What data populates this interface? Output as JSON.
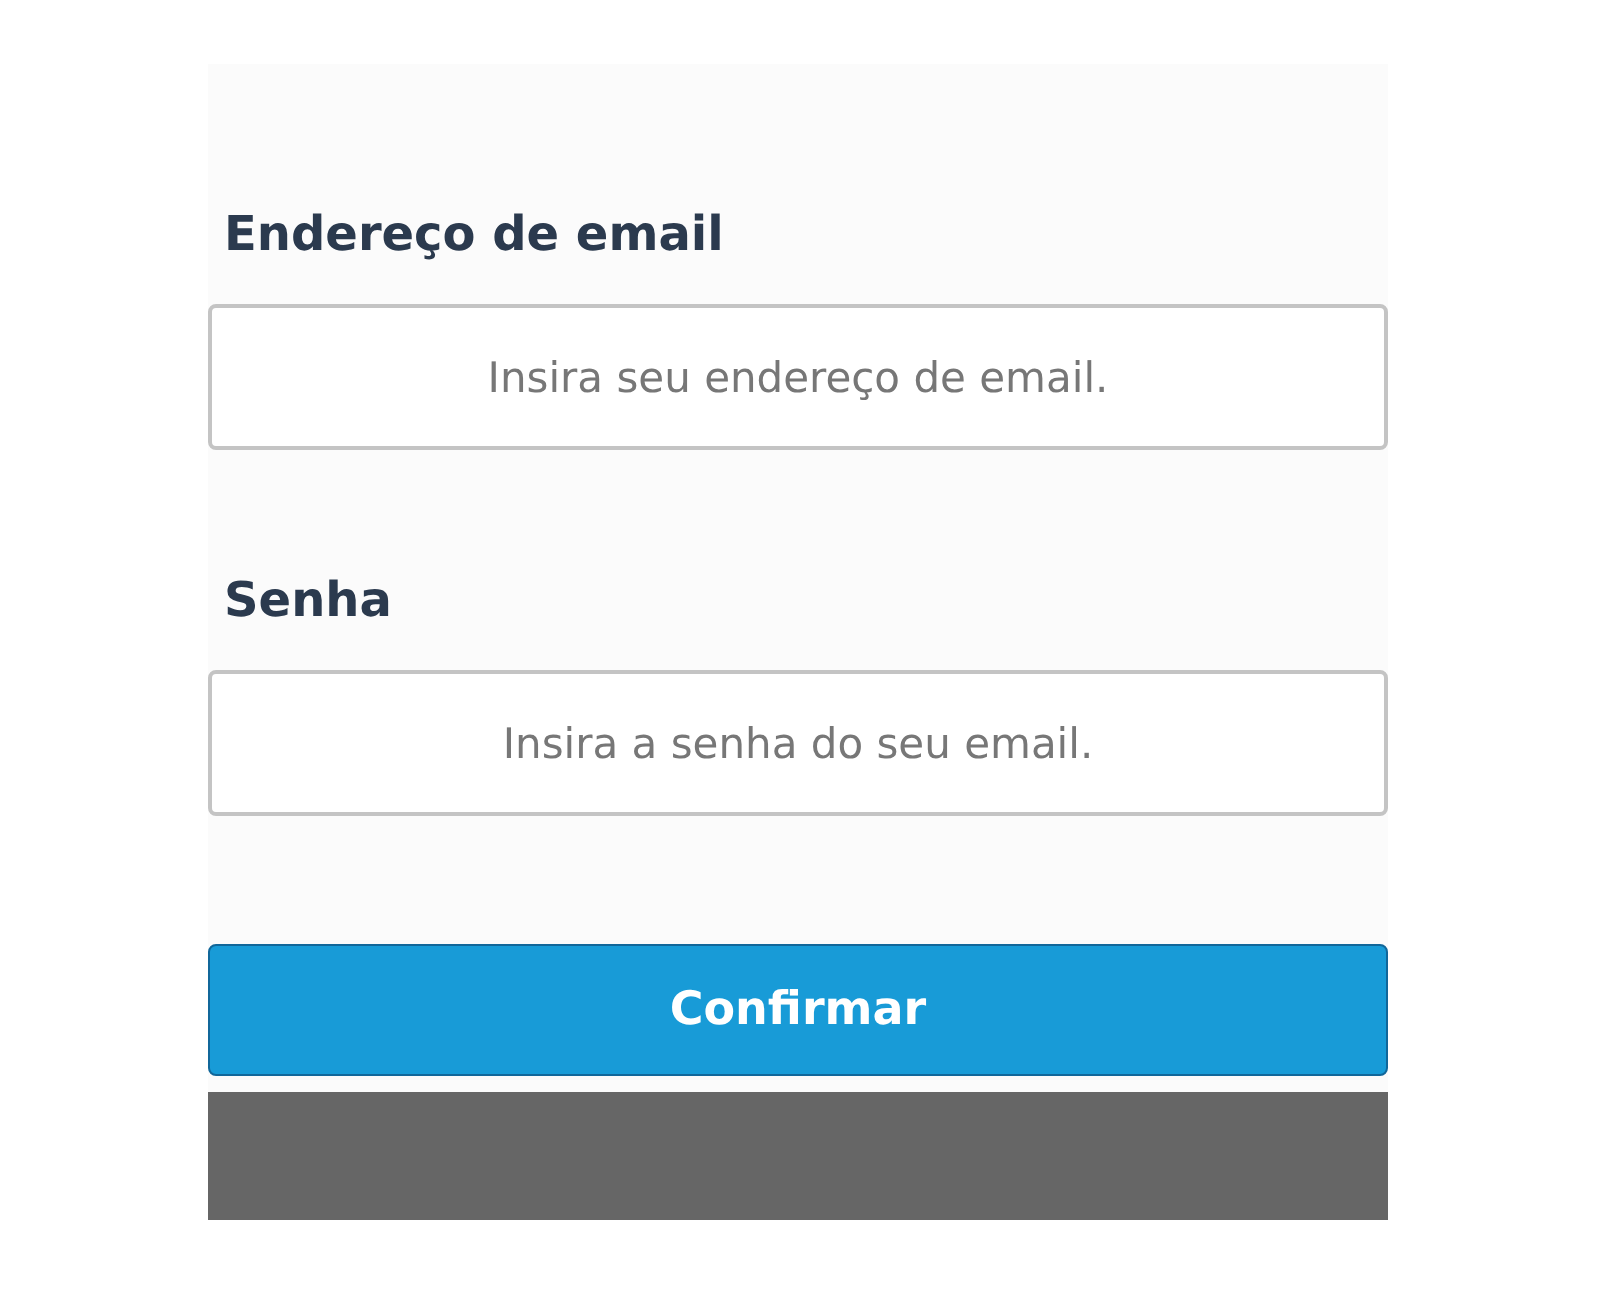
{
  "fields": [
    {
      "label": "Endereço de email",
      "placeholder": "Insira seu endereço de email."
    },
    {
      "label": "Senha",
      "placeholder": "Insira a senha do seu email."
    }
  ],
  "button": "Confirmar"
}
